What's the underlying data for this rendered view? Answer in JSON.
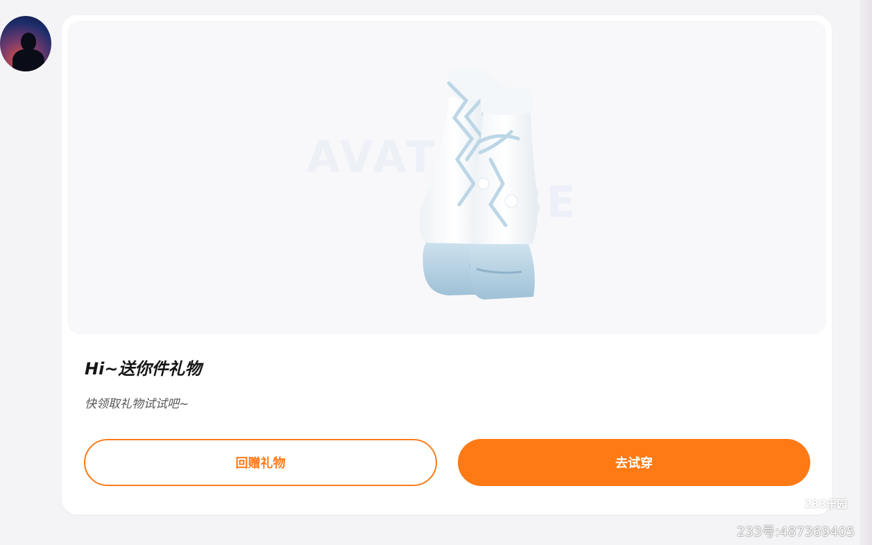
{
  "gift_card": {
    "title": "Hi~送你件礼物",
    "subtitle": "快领取礼物试试吧~",
    "image_watermark_top": "AVATAR",
    "image_watermark_bottom": "VIBE",
    "item_icon": "fluffy-boots-image"
  },
  "actions": {
    "return_gift_label": "回赠礼物",
    "try_on_label": "去试穿"
  },
  "overlay": {
    "logo_text": "233乐园",
    "user_id": "233号:487369405"
  },
  "colors": {
    "accent": "#ff7a14",
    "title": "#151515",
    "subtitle": "#575757"
  }
}
